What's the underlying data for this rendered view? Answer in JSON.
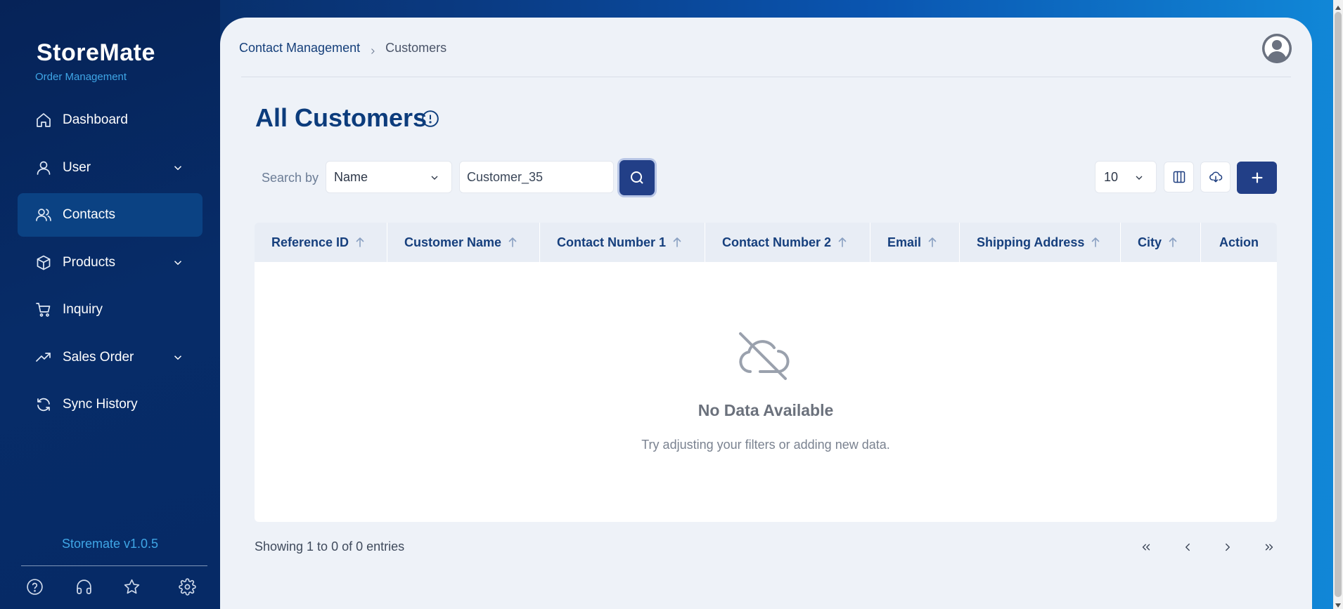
{
  "sidebar": {
    "logo": "StoreMate",
    "subtitle": "Order Management",
    "items": [
      {
        "label": "Dashboard",
        "icon": "home-icon"
      },
      {
        "label": "User",
        "icon": "user-icon",
        "expandable": true
      },
      {
        "label": "Contacts",
        "icon": "users-icon",
        "active": true
      },
      {
        "label": "Products",
        "icon": "box-icon",
        "expandable": true
      },
      {
        "label": "Inquiry",
        "icon": "cart-icon"
      },
      {
        "label": "Sales Order",
        "icon": "trending-icon",
        "expandable": true
      },
      {
        "label": "Sync History",
        "icon": "refresh-icon"
      }
    ],
    "version": "Storemate v1.0.5",
    "bottom_icons": [
      "help-icon",
      "headset-icon",
      "star-icon",
      "settings-icon"
    ]
  },
  "header": {
    "breadcrumb": [
      "Contact Management",
      "Customers"
    ]
  },
  "page": {
    "title": "All Customers"
  },
  "toolbar": {
    "search_by_label": "Search by",
    "search_field_selected": "Name",
    "search_value": "Customer_35",
    "per_page": "10"
  },
  "table": {
    "columns": [
      "Reference ID",
      "Customer Name",
      "Contact Number 1",
      "Contact Number 2",
      "Email",
      "Shipping Address",
      "City",
      "Action"
    ],
    "rows": [],
    "empty_title": "No Data Available",
    "empty_subtitle": "Try adjusting your filters or adding new data."
  },
  "footer": {
    "showing": "Showing 1 to 0 of 0 entries"
  },
  "colors": {
    "accent": "#223f87",
    "title": "#0c3c7c",
    "sidebar_bg": "#062358",
    "version": "#3fa6e6"
  }
}
